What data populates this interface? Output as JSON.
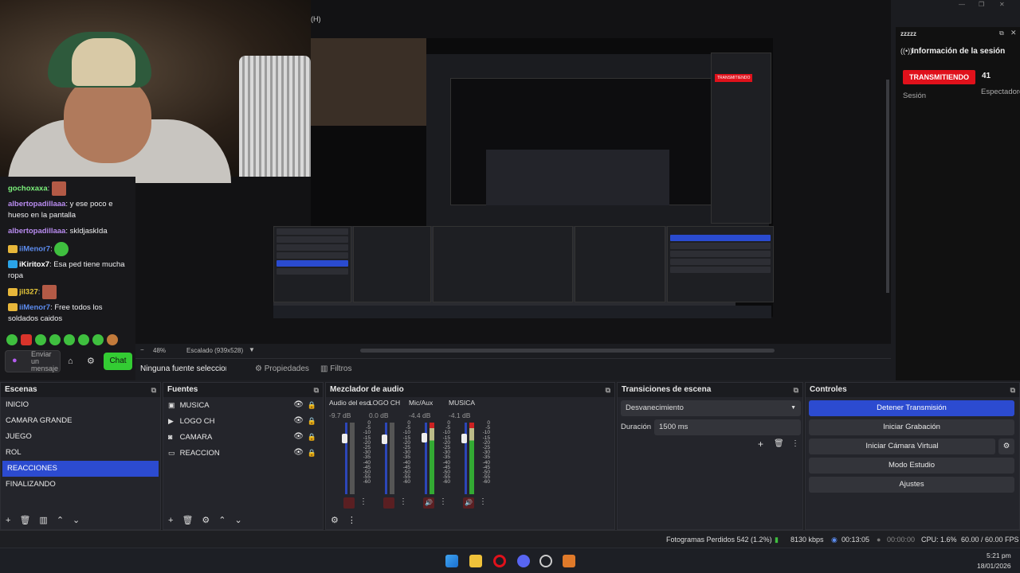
{
  "preview": {
    "menu_hint": "(H)",
    "zoom": "48%",
    "scaling": "Escalado (939x528)",
    "no_source": "Ninguna fuente seleccionada",
    "properties": "Propiedades",
    "filters": "Filtros"
  },
  "chat": {
    "messages": [
      {
        "user": "gochoxaxa",
        "text": "",
        "color": "#7cf27c"
      },
      {
        "user": "albertopadillaaa",
        "text": "y ese poco e hueso en la pantalla",
        "color": "#b98cf0"
      },
      {
        "user": "albertopadillaaa",
        "text": "skldjaskIda",
        "color": "#b98cf0"
      },
      {
        "user": "iiMenor7",
        "text": "",
        "color": "#5c8cf0"
      },
      {
        "user": "iKiritox7",
        "text": "Esa ped tiene mucha ropa",
        "color": "#ffffff"
      },
      {
        "user": "jil327",
        "text": "",
        "color": "#e8c93a"
      },
      {
        "user": "iiMenor7",
        "text": "Free todos los soldados caidos",
        "color": "#5c8cf0"
      }
    ],
    "input_placeholder": "Enviar un mensaje",
    "send_label": "Chat"
  },
  "side": {
    "title": "zzzzz",
    "header": "Información de la sesión",
    "status": "TRANSMITIENDO",
    "viewers": "41",
    "session_label": "Sesión",
    "viewers_label": "Espectadores"
  },
  "docks": {
    "scenes": {
      "title": "Escenas",
      "items": [
        "INICIO",
        "CAMARA GRANDE",
        "JUEGO",
        "ROL",
        "REACCIONES",
        "FINALIZANDO"
      ],
      "selected": "REACCIONES"
    },
    "sources": {
      "title": "Fuentes",
      "items": [
        {
          "label": "MUSICA",
          "icon": "window-icon"
        },
        {
          "label": "LOGO CH",
          "icon": "play-icon"
        },
        {
          "label": "CAMARA",
          "icon": "camera-icon"
        },
        {
          "label": "REACCION",
          "icon": "monitor-icon"
        }
      ]
    },
    "mixer": {
      "title": "Mezclador de audio",
      "channels": [
        {
          "name": "Audio del escritorio",
          "db": "-9.7 dB",
          "level": 0.2,
          "muted": true
        },
        {
          "name": "LOGO CH",
          "db": "0.0 dB",
          "level": 0.0,
          "muted": true
        },
        {
          "name": "Mic/Aux",
          "db": "-4.4 dB",
          "level": 0.85,
          "muted": false
        },
        {
          "name": "MUSICA",
          "db": "-4.1 dB",
          "level": 0.85,
          "muted": false
        }
      ],
      "scale": [
        "0",
        "-5",
        "-10",
        "-15",
        "-20",
        "-25",
        "-30",
        "-35",
        "-40",
        "-45",
        "-50",
        "-55",
        "-60"
      ]
    },
    "transitions": {
      "title": "Transiciones de escena",
      "selected": "Desvanecimiento",
      "duration_label": "Duración",
      "duration": "1500 ms"
    },
    "controls": {
      "title": "Controles",
      "buttons": [
        "Detener Transmisión",
        "Iniciar Grabación",
        "Iniciar Cámara Virtual",
        "Modo Estudio",
        "Ajustes"
      ]
    }
  },
  "status": {
    "dropped": "Fotogramas Perdidos 542 (1.2%)",
    "bitrate": "8130 kbps",
    "live_time": "00:13:05",
    "rec_time": "00:00:00",
    "cpu": "CPU: 1.6%",
    "fps": "60.00 / 60.00 FPS"
  },
  "taskbar": {
    "time": "5:21 pm",
    "date": "18/01/2026"
  },
  "colors": {
    "accent": "#2c4bd0",
    "live": "#e0111b",
    "chat_button": "#33cc33"
  }
}
